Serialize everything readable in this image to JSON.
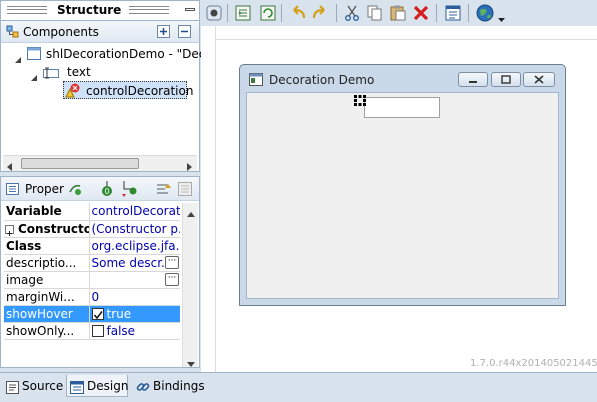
{
  "structure": {
    "title": "Structure"
  },
  "components": {
    "title": "Components",
    "tree": [
      {
        "label": "shlDecorationDemo - \"Deco"
      },
      {
        "label": "text"
      },
      {
        "label": "controlDecoration"
      }
    ]
  },
  "properties": {
    "title": "Proper",
    "rows": [
      {
        "key": "Variable",
        "value": "controlDecorat..."
      },
      {
        "key": "Constructor",
        "value": "(Constructor p..."
      },
      {
        "key": "Class",
        "value": "org.eclipse.jfa..."
      },
      {
        "key": "descriptio...",
        "value": "Some descr..."
      },
      {
        "key": "image",
        "value": ""
      },
      {
        "key": "marginWi...",
        "value": "0"
      },
      {
        "key": "showHover",
        "value": "true"
      },
      {
        "key": "showOnly...",
        "value": "false"
      }
    ]
  },
  "shell": {
    "title": "Decoration Demo"
  },
  "version": "1.7.0.r44x201405021445",
  "bottom_tabs": {
    "source": "Source",
    "design": "Design",
    "bindings": "Bindings"
  },
  "colors": {
    "selection": "#3399ff",
    "frame": "#d9e3ee",
    "value_text": "#0000b0"
  }
}
